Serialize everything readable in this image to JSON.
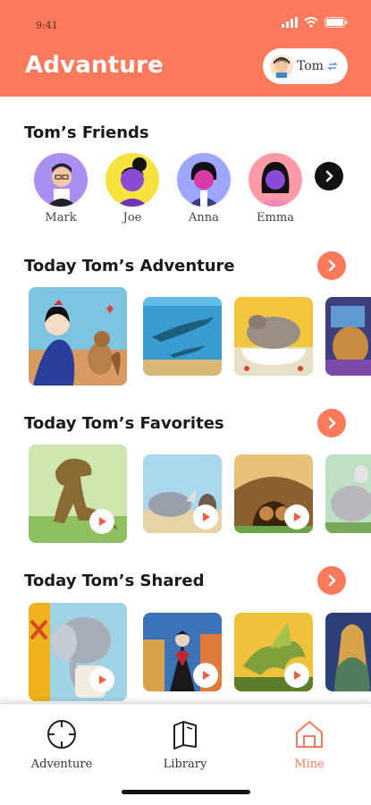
{
  "status_bar": {
    "time": "9:41"
  },
  "header": {
    "title": "Advanture",
    "user_name": "Tom",
    "brand_color": "#fb7a5b"
  },
  "friends": {
    "title": "Tom’s Friends",
    "items": [
      {
        "name": "Mark",
        "bg": "#a98ff0"
      },
      {
        "name": "Joe",
        "bg": "#f5e23f"
      },
      {
        "name": "Anna",
        "bg": "#9ea6ff"
      },
      {
        "name": "Emma",
        "bg": "#ff9aa8"
      }
    ],
    "next_icon": "chevron-right-icon"
  },
  "sections": [
    {
      "title": "Today Tom’s Adventure",
      "icon": "chevron-right-icon"
    },
    {
      "title": "Today Tom’s Favorites",
      "icon": "chevron-right-icon"
    },
    {
      "title": "Today Tom’s Shared",
      "icon": "chevron-right-icon"
    }
  ],
  "tabbar": {
    "items": [
      {
        "label": "Adventure",
        "icon": "crosshair-icon"
      },
      {
        "label": "Library",
        "icon": "book-icon"
      },
      {
        "label": "Mine",
        "icon": "home-icon",
        "active": true
      }
    ]
  }
}
